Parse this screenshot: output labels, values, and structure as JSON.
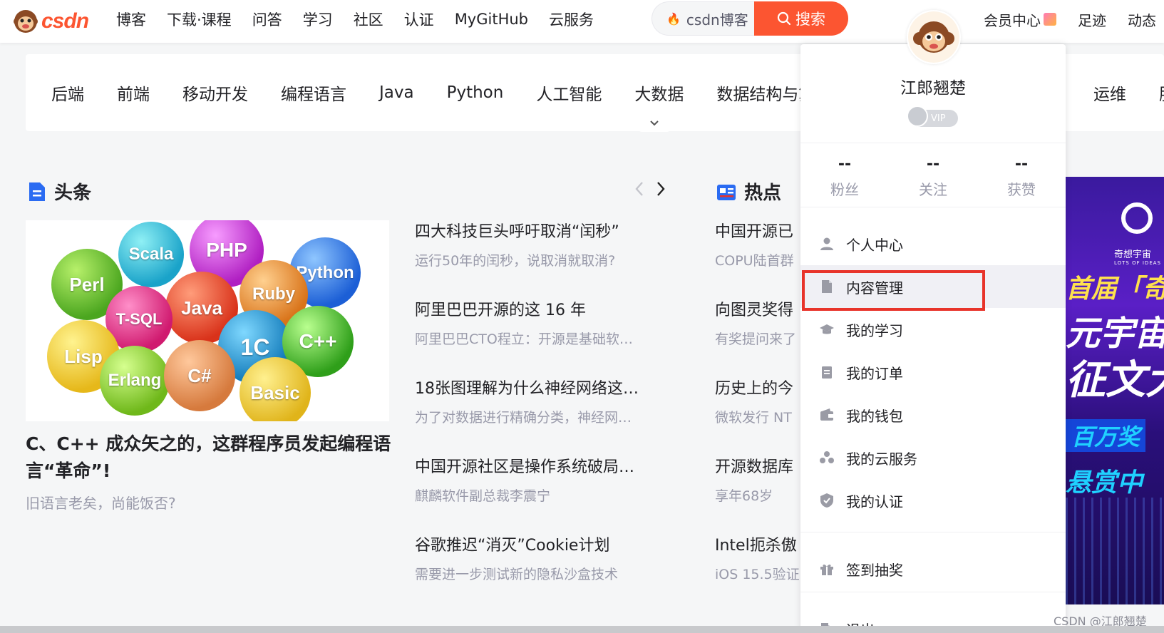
{
  "header": {
    "logo_text": "csdn",
    "nav": [
      "博客",
      "下载·课程",
      "问答",
      "学习",
      "社区",
      "认证",
      "MyGitHub",
      "云服务"
    ],
    "search_placeholder": "csdn博客",
    "search_button": "搜索",
    "right_links": [
      "会员中心",
      "足迹",
      "动态"
    ]
  },
  "categories": {
    "items": [
      "后端",
      "前端",
      "移动开发",
      "编程语言",
      "Java",
      "Python",
      "人工智能",
      "大数据",
      "数据结构与算"
    ],
    "right_items": [
      "运维",
      "服"
    ]
  },
  "headline": {
    "title": "头条",
    "lead_title": "C、C++ 成众矢之的，这群程序员发起编程语言“革命”!",
    "lead_subtitle": "旧语言老矣，尚能饭否?",
    "image_balls": [
      "Perl",
      "Scala",
      "PHP",
      "Python",
      "Ruby",
      "Java",
      "T-SQL",
      "Lisp",
      "1C",
      "C++",
      "Erlang",
      "C#",
      "Basic"
    ],
    "news": [
      {
        "title": "四大科技巨头呼吁取消“闰秒”",
        "sub": "运行50年的闰秒，说取消就取消?"
      },
      {
        "title": "阿里巴巴开源的这 16 年",
        "sub": "阿里巴巴CTO程立：开源是基础软…"
      },
      {
        "title": "18张图理解为什么神经网络这…",
        "sub": "为了对数据进行精确分类，神经网…"
      },
      {
        "title": "中国开源社区是操作系统破局…",
        "sub": "麒麟软件副总裁李震宁"
      },
      {
        "title": "谷歌推迟“消灭”Cookie计划",
        "sub": "需要进一步测试新的隐私沙盒技术"
      }
    ]
  },
  "hot": {
    "title": "热点",
    "items": [
      {
        "title": "中国开源已",
        "sub": "COPU陆首群"
      },
      {
        "title": "向图灵奖得",
        "sub": "有奖提问来了"
      },
      {
        "title": "历史上的今",
        "sub": "微软发行 NT"
      },
      {
        "title": "开源数据库",
        "sub": "享年68岁"
      },
      {
        "title": "Intel扼杀傲",
        "sub": "iOS 15.5验证"
      }
    ]
  },
  "user_menu": {
    "username": "江郎翘楚",
    "vip_label": "VIP",
    "stats": [
      {
        "value": "--",
        "label": "粉丝"
      },
      {
        "value": "--",
        "label": "关注"
      },
      {
        "value": "--",
        "label": "获赞"
      }
    ],
    "items": [
      "个人中心",
      "内容管理",
      "我的学习",
      "我的订单",
      "我的钱包",
      "我的云服务",
      "我的认证"
    ],
    "extra": [
      "签到抽奖",
      "退出"
    ]
  },
  "banner": {
    "brand": "奇想宇宙",
    "tagline": "LOTS OF IDEAS",
    "lines": [
      "首届「奇",
      "元宇宙",
      "征文大",
      "百万奖",
      "悬赏中"
    ]
  },
  "watermark": "CSDN @江郎翘楚"
}
